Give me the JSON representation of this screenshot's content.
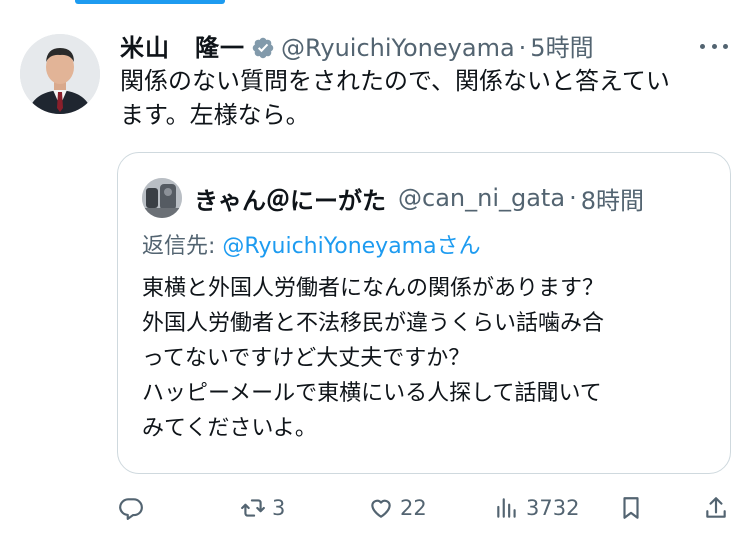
{
  "tweet": {
    "author_name": "米山　隆一",
    "handle": "@RyuichiYoneyama",
    "separator": "·",
    "time": "5時間",
    "text_lines": [
      "関係のない質問をされたので、関係ないと答えてい",
      "ます。左様なら。"
    ]
  },
  "quoted": {
    "author_name": "きゃん＠にーがた",
    "handle": "@can_ni_gata",
    "separator": "·",
    "time": "8時間",
    "reply_prefix": "返信先: ",
    "reply_mention": "@RyuichiYoneyamaさん",
    "text_lines": [
      "東横と外国人労働者になんの関係があります？",
      "外国人労働者と不法移民が違うくらい話噛み合",
      "ってないですけど大丈夫ですか？",
      "ハッピーメールで東横にいる人探して話聞いて",
      "みてくださいよ。"
    ]
  },
  "actions": {
    "reply_count": "",
    "retweet_count": "3",
    "like_count": "22",
    "view_count": "3732"
  },
  "colors": {
    "accent": "#1d9bf0",
    "muted": "#536471",
    "border": "#cfd9de",
    "text": "#0f1419"
  }
}
